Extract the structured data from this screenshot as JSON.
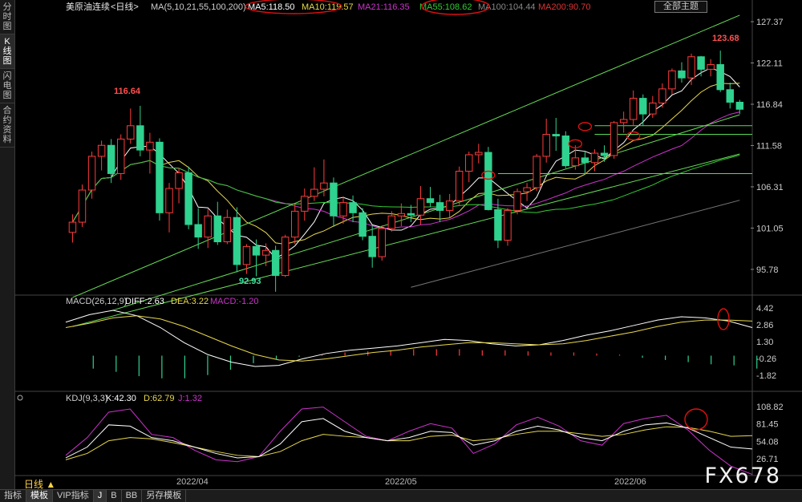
{
  "sidebar": {
    "tabs": [
      "分时图",
      "K线图",
      "闪电图",
      "合约资料"
    ]
  },
  "header": {
    "symbol": "美原油连续",
    "period_tag": "<日线>",
    "ma_params": "MA(5,10,21,55,100,200)",
    "ma": [
      {
        "label": "MA5:118.50",
        "color": "#ffffff"
      },
      {
        "label": "MA10:119.57",
        "color": "#e8d84a"
      },
      {
        "label": "MA21:116.35",
        "color": "#cc33cc"
      },
      {
        "label": "MA55:108.62",
        "color": "#33cc33"
      },
      {
        "label": "MA100:104.44",
        "color": "#888888"
      },
      {
        "label": "MA200:90.70",
        "color": "#dd3333"
      }
    ],
    "theme_button": "全部主题"
  },
  "annotations": {
    "high": "116.64",
    "top": "123.68",
    "low": "92.93"
  },
  "price_axis": [
    "127.37",
    "122.11",
    "116.84",
    "111.58",
    "106.31",
    "101.05",
    "95.78"
  ],
  "macd": {
    "title": "MACD(26,12,9)",
    "diff": "DIFF:2.63",
    "dea": "DEA:3.22",
    "macd": "MACD:-1.20",
    "axis": [
      "4.42",
      "2.86",
      "1.30",
      "-0.26",
      "-1.82"
    ]
  },
  "kdj": {
    "title": "KDJ(9,3,3)",
    "k": "K:42.30",
    "d": "D:62.79",
    "j": "J:1.32",
    "axis": [
      "108.82",
      "81.45",
      "54.08",
      "26.71"
    ]
  },
  "x_labels": [
    "2022/04",
    "2022/05",
    "2022/06"
  ],
  "bottom_tabs": [
    "指标",
    "模板",
    "VIP指标",
    "J",
    "B",
    "BB",
    "另存模板"
  ],
  "period": "日线 ▲",
  "watermark": "FX678",
  "colors": {
    "up": "#ff3b3b",
    "down": "#2fd28f",
    "bg": "#000000",
    "ma5": "#ffffff",
    "ma10": "#e8d84a",
    "ma21": "#cc33cc",
    "ma55": "#33cc33",
    "ma100": "#888888",
    "channel": "#66dd55"
  },
  "chart_data": {
    "type": "candlestick",
    "ylim": [
      92.5,
      128.5
    ],
    "candles": [
      [
        100.5,
        102.8,
        99.2,
        101.8
      ],
      [
        101.8,
        106.6,
        101.2,
        105.9
      ],
      [
        105.9,
        110.8,
        104.8,
        110.2
      ],
      [
        110.2,
        112.2,
        108.4,
        111.6
      ],
      [
        111.6,
        112.4,
        106.8,
        108.0
      ],
      [
        108.0,
        113.0,
        107.2,
        112.4
      ],
      [
        112.4,
        116.3,
        111.8,
        114.1
      ],
      [
        114.1,
        116.64,
        110.2,
        111.0
      ],
      [
        111.0,
        113.2,
        108.0,
        112.0
      ],
      [
        112.0,
        112.5,
        102.0,
        103.0
      ],
      [
        103.0,
        106.8,
        100.5,
        106.1
      ],
      [
        106.1,
        108.7,
        104.2,
        108.1
      ],
      [
        108.1,
        108.9,
        100.9,
        101.5
      ],
      [
        101.5,
        103.6,
        98.4,
        99.9
      ],
      [
        99.9,
        103.5,
        98.5,
        102.6
      ],
      [
        102.6,
        104.4,
        98.9,
        99.3
      ],
      [
        99.3,
        103.4,
        99.0,
        102.4
      ],
      [
        102.4,
        103.7,
        95.4,
        96.4
      ],
      [
        96.4,
        99.0,
        95.2,
        98.7
      ],
      [
        98.7,
        99.6,
        94.9,
        97.6
      ],
      [
        97.6,
        99.1,
        96.2,
        98.2
      ],
      [
        98.2,
        98.8,
        92.93,
        95.0
      ],
      [
        95.0,
        100.2,
        94.8,
        99.9
      ],
      [
        99.9,
        104.1,
        99.0,
        103.2
      ],
      [
        103.2,
        106.1,
        102.0,
        105.1
      ],
      [
        105.1,
        108.8,
        104.5,
        106.0
      ],
      [
        106.0,
        109.8,
        105.1,
        106.8
      ],
      [
        106.8,
        107.5,
        101.2,
        102.6
      ],
      [
        102.6,
        105.1,
        101.6,
        104.3
      ],
      [
        104.3,
        105.2,
        101.8,
        103.0
      ],
      [
        103.0,
        103.6,
        99.5,
        100.0
      ],
      [
        100.0,
        101.3,
        96.0,
        97.4
      ],
      [
        97.4,
        101.4,
        96.9,
        101.0
      ],
      [
        101.0,
        103.2,
        100.6,
        102.6
      ],
      [
        102.6,
        104.2,
        101.3,
        102.9
      ],
      [
        102.9,
        104.0,
        101.8,
        102.7
      ],
      [
        102.7,
        106.4,
        101.5,
        104.8
      ],
      [
        104.8,
        106.3,
        103.7,
        104.3
      ],
      [
        104.3,
        105.3,
        101.8,
        103.3
      ],
      [
        103.3,
        105.4,
        102.4,
        104.5
      ],
      [
        104.5,
        108.9,
        104.0,
        108.3
      ],
      [
        108.3,
        110.8,
        106.9,
        110.4
      ],
      [
        110.4,
        111.8,
        109.3,
        110.7
      ],
      [
        110.7,
        111.4,
        103.3,
        103.4
      ],
      [
        103.4,
        104.8,
        98.5,
        99.5
      ],
      [
        99.5,
        103.6,
        98.8,
        103.3
      ],
      [
        103.3,
        106.1,
        102.8,
        105.7
      ],
      [
        105.7,
        106.8,
        104.5,
        106.2
      ],
      [
        106.2,
        110.5,
        105.8,
        110.2
      ],
      [
        110.2,
        115.0,
        109.4,
        113.0
      ],
      [
        113.0,
        115.1,
        110.9,
        112.8
      ],
      [
        112.8,
        113.4,
        108.7,
        109.0
      ],
      [
        109.0,
        111.6,
        108.5,
        110.0
      ],
      [
        110.0,
        110.8,
        107.9,
        109.4
      ],
      [
        109.4,
        111.1,
        108.3,
        110.6
      ],
      [
        110.6,
        111.6,
        109.5,
        110.3
      ],
      [
        110.3,
        114.7,
        109.9,
        114.5
      ],
      [
        114.5,
        115.9,
        113.2,
        114.9
      ],
      [
        114.9,
        118.6,
        114.2,
        117.6
      ],
      [
        117.6,
        118.1,
        114.1,
        115.6
      ],
      [
        115.6,
        117.9,
        115.1,
        117.0
      ],
      [
        117.0,
        119.5,
        116.4,
        118.8
      ],
      [
        118.8,
        121.4,
        118.1,
        121.1
      ],
      [
        121.1,
        122.2,
        119.6,
        120.2
      ],
      [
        120.2,
        123.3,
        119.3,
        122.9
      ],
      [
        122.9,
        123.0,
        120.4,
        121.3
      ],
      [
        121.3,
        122.6,
        120.4,
        121.9
      ],
      [
        121.9,
        123.68,
        118.4,
        118.7
      ],
      [
        118.7,
        119.6,
        116.3,
        117.1
      ],
      [
        117.1,
        117.4,
        115.6,
        116.2
      ]
    ],
    "macd_hist": [
      -1.2,
      -1.5,
      -1.9,
      -2.1,
      -2.1,
      -1.8,
      -1.3,
      -0.7,
      -0.3,
      -0.1,
      0.1,
      0.3,
      0.4,
      0.5,
      0.6,
      0.6,
      0.6,
      0.5,
      0.5,
      0.4,
      0.3,
      0.3,
      0.2,
      0.1,
      -0.2,
      -0.4,
      -0.6,
      -0.8,
      -0.9,
      -1.2
    ],
    "kdj_axis": [
      26.71,
      108.82
    ]
  }
}
